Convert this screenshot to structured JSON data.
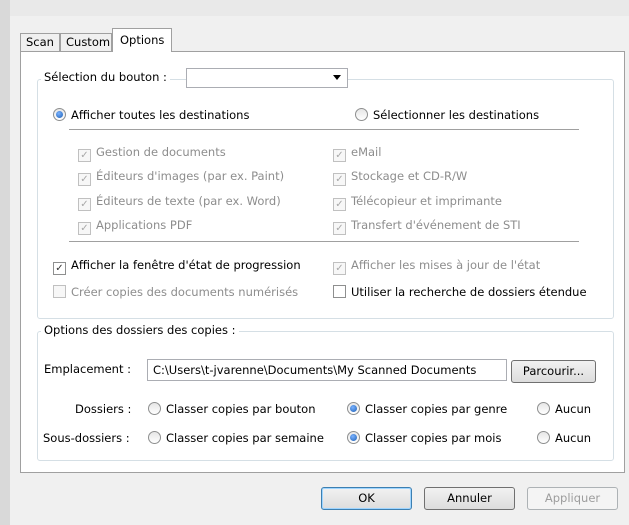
{
  "tabs": [
    "Scan",
    "Custom",
    "Options"
  ],
  "button_selection": {
    "legend": "Sélection du bouton :",
    "value": ""
  },
  "destinations": {
    "show_all_label": "Afficher toutes les destinations",
    "select_label": "Sélectionner les destinations",
    "left": [
      "Gestion de documents",
      "Éditeurs d'images (par ex. Paint)",
      "Éditeurs de texte (par ex. Word)",
      "Applications PDF"
    ],
    "right": [
      "eMail",
      "Stockage et CD-R/W",
      "Télécopieur et imprimante",
      "Transfert d'événement de STI"
    ]
  },
  "options": {
    "show_progress": "Afficher la fenêtre d'état de progression",
    "show_status_updates": "Afficher les mises à jour de l'état",
    "create_copies": "Créer copies des documents numérisés",
    "extended_search": "Utiliser la recherche de dossiers étendue"
  },
  "copies": {
    "legend": "Options des dossiers des copies :",
    "location_label": "Emplacement :",
    "location_value": "C:\\Users\\t-jvarenne\\Documents\\My Scanned Documents",
    "browse_label": "Parcourir...",
    "folders_label": "Dossiers :",
    "folders_options": [
      "Classer copies par bouton",
      "Classer copies par genre",
      "Aucun"
    ],
    "subfolders_label": "Sous-dossiers :",
    "subfolders_options": [
      "Classer copies par semaine",
      "Classer copies par mois",
      "Aucun"
    ]
  },
  "footer": {
    "ok": "OK",
    "cancel": "Annuler",
    "apply": "Appliquer"
  },
  "icons": {
    "radio_checked": "radio-checked-icon",
    "checkbox_checked": "checkmark-icon",
    "dropdown": "chevron-down-icon"
  }
}
